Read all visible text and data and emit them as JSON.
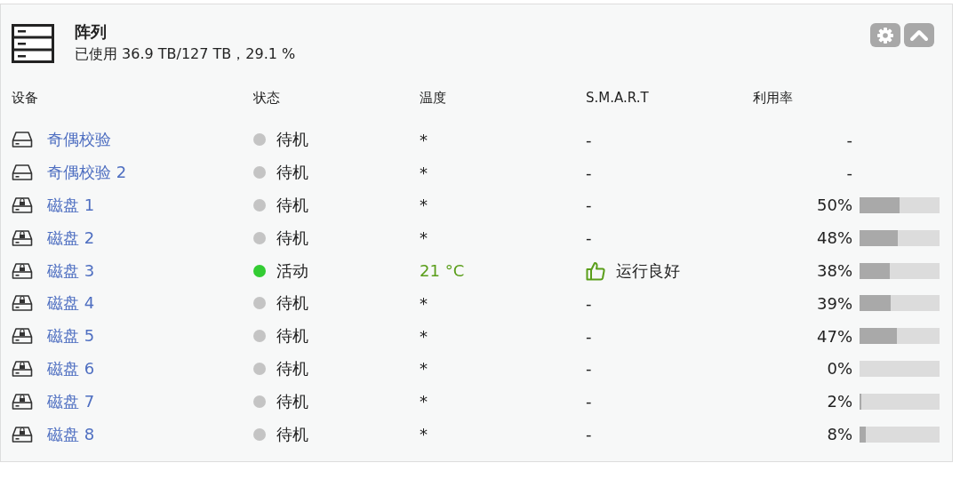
{
  "panel": {
    "title": "阵列",
    "subtitle": "已使用 36.9 TB/127 TB，29.1 %"
  },
  "columns": [
    "设备",
    "状态",
    "温度",
    "S.M.A.R.T",
    "利用率"
  ],
  "rows": [
    {
      "kind": "parity",
      "name": "奇偶校验",
      "status": "待机",
      "color": "#c4c4c4",
      "active": false,
      "temperature": "*",
      "smart": "-",
      "smart_ok": false,
      "usage": "-"
    },
    {
      "kind": "parity",
      "name": "奇偶校验 2",
      "status": "待机",
      "color": "#c4c4c4",
      "active": false,
      "temperature": "*",
      "smart": "-",
      "smart_ok": false,
      "usage": "-"
    },
    {
      "kind": "disk",
      "name": "磁盘 1",
      "status": "待机",
      "color": "#c4c4c4",
      "active": false,
      "temperature": "*",
      "smart": "-",
      "smart_ok": false,
      "usage": "50%",
      "level": 0.5
    },
    {
      "kind": "disk",
      "name": "磁盘 2",
      "status": "待机",
      "color": "#c4c4c4",
      "active": false,
      "temperature": "*",
      "smart": "-",
      "smart_ok": false,
      "usage": "48%",
      "level": 0.48
    },
    {
      "kind": "disk",
      "name": "磁盘 3",
      "status": "活动",
      "color": "#33cc33",
      "active": true,
      "temperature": "21 °C",
      "smart": "运行良好",
      "smart_ok": true,
      "usage": "38%",
      "level": 0.38
    },
    {
      "kind": "disk",
      "name": "磁盘 4",
      "status": "待机",
      "color": "#c4c4c4",
      "active": false,
      "temperature": "*",
      "smart": "-",
      "smart_ok": false,
      "usage": "39%",
      "level": 0.39
    },
    {
      "kind": "disk",
      "name": "磁盘 5",
      "status": "待机",
      "color": "#c4c4c4",
      "active": false,
      "temperature": "*",
      "smart": "-",
      "smart_ok": false,
      "usage": "47%",
      "level": 0.47
    },
    {
      "kind": "disk",
      "name": "磁盘 6",
      "status": "待机",
      "color": "#c4c4c4",
      "active": false,
      "temperature": "*",
      "smart": "-",
      "smart_ok": false,
      "usage": "0%",
      "level": 0
    },
    {
      "kind": "disk",
      "name": "磁盘 7",
      "status": "待机",
      "color": "#c4c4c4",
      "active": false,
      "temperature": "*",
      "smart": "-",
      "smart_ok": false,
      "usage": "2%",
      "level": 0.02
    },
    {
      "kind": "disk",
      "name": "磁盘 8",
      "status": "待机",
      "color": "#c4c4c4",
      "active": false,
      "temperature": "*",
      "smart": "-",
      "smart_ok": false,
      "usage": "8%",
      "level": 0.08
    }
  ]
}
